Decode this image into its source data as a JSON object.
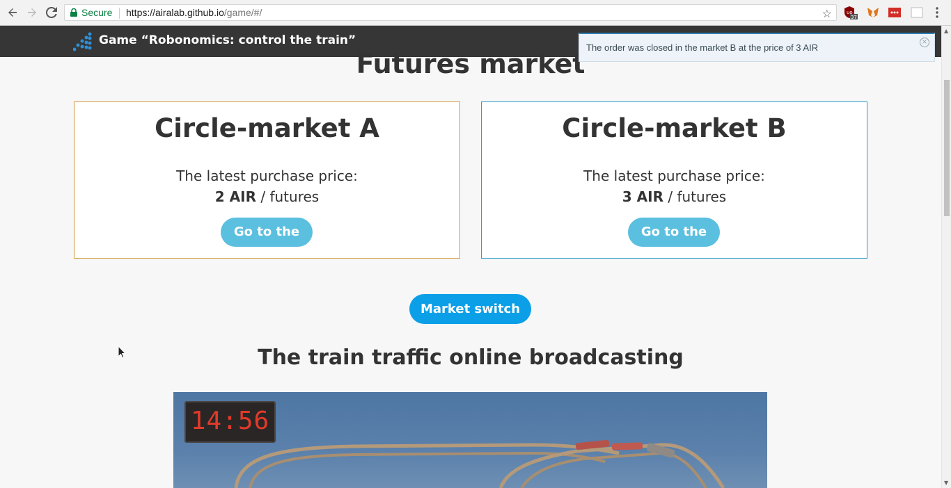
{
  "browser": {
    "secure_label": "Secure",
    "url_host": "https://airalab.github.io",
    "url_path": "/game/#/",
    "extension_badge": "37"
  },
  "header": {
    "title": "Game “Robonomics: control the train”"
  },
  "notification": {
    "message": "The order was closed in the market B at the price of 3 AIR",
    "close_label": "×"
  },
  "main": {
    "section_title": "Futures market",
    "markets": [
      {
        "name": "Circle-market A",
        "price_label": "The latest purchase price:",
        "price_value": "2 AIR",
        "price_unit": " / futures",
        "button_label": "Go to the"
      },
      {
        "name": "Circle-market B",
        "price_label": "The latest purchase price:",
        "price_value": "3 AIR",
        "price_unit": " / futures",
        "button_label": "Go to the"
      }
    ],
    "switch_label": "Market switch",
    "broadcast_title": "The train traffic online broadcasting",
    "clock_time": "14:56"
  },
  "colors": {
    "market_a_border": "#d39b3a",
    "market_b_border": "#2a9bc5",
    "goto_button": "#5bbfdf",
    "switch_button": "#0b9fe8",
    "header_bg": "#363636"
  }
}
